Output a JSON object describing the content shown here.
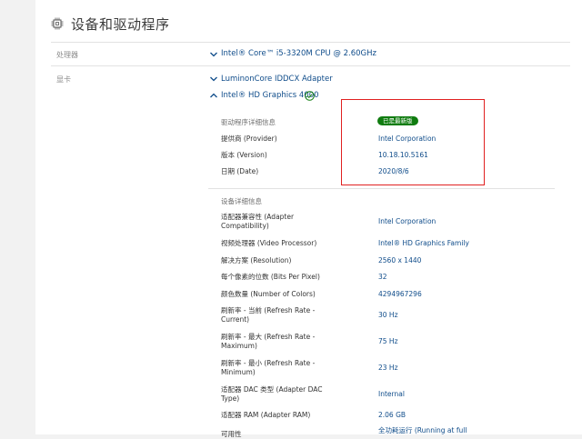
{
  "header": {
    "title": "设备和驱动程序",
    "icon": "chip-icon"
  },
  "processor": {
    "label": "处理器",
    "value": "Intel® Core™ i5-3320M CPU @ 2.60GHz"
  },
  "graphics": {
    "label": "显卡",
    "adapters": [
      {
        "name": "LuminonCore IDDCX Adapter"
      },
      {
        "name": "Intel® HD Graphics 4000"
      }
    ]
  },
  "driver": {
    "section_title": "驱动程序详细信息",
    "badge": "已是最新版",
    "rows": [
      {
        "label": "提供商 (Provider)",
        "value": "Intel Corporation"
      },
      {
        "label": "版本 (Version)",
        "value": "10.18.10.5161"
      },
      {
        "label": "日期 (Date)",
        "value": "2020/8/6"
      }
    ]
  },
  "device": {
    "section_title": "设备详细信息",
    "rows": [
      {
        "label": "适配器兼容性 (Adapter Compatibility)",
        "value": "Intel Corporation"
      },
      {
        "label": "视频处理器 (Video Processor)",
        "value": "Intel® HD Graphics Family"
      },
      {
        "label": "解决方案 (Resolution)",
        "value": "2560 x 1440"
      },
      {
        "label": "每个像素的位数 (Bits Per Pixel)",
        "value": "32"
      },
      {
        "label": "颜色数量 (Number of Colors)",
        "value": "4294967296"
      },
      {
        "label": "刷新率 - 当前 (Refresh Rate - Current)",
        "value": "30 Hz"
      },
      {
        "label": "刷新率 - 最大 (Refresh Rate - Maximum)",
        "value": "75 Hz"
      },
      {
        "label": "刷新率 - 最小 (Refresh Rate - Minimum)",
        "value": "23 Hz"
      },
      {
        "label": "适配器 DAC 类型 (Adapter DAC Type)",
        "value": "Internal"
      },
      {
        "label": "适配器 RAM (Adapter RAM)",
        "value": "2.06 GB"
      },
      {
        "label": "可用性",
        "value": "全功耗运行 (Running at full"
      }
    ]
  },
  "colors": {
    "link": "#0f4c8a",
    "badge": "#107c10",
    "highlight": "#e02020"
  }
}
